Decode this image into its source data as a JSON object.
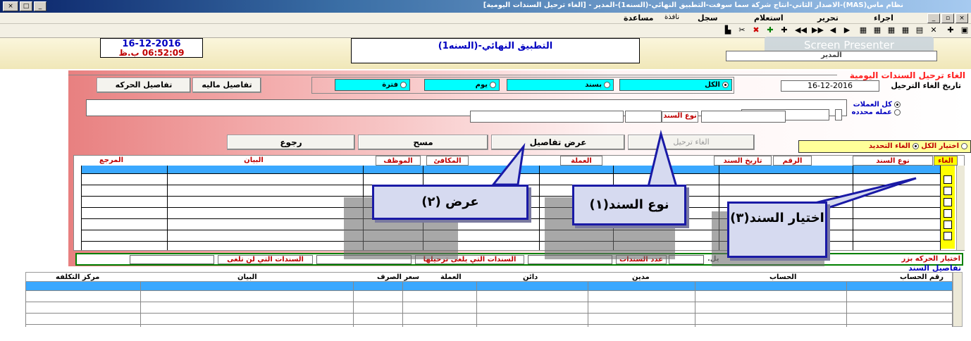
{
  "window": {
    "title": "نظام ماس(MAS)-الاصدار الثاني-انتاج شركة سما سوفت-التطبيق النهائي-(السنه1)-المدير - [الغاء ترحيل السندات اليومية]",
    "min": "_",
    "max": "□",
    "close": "×"
  },
  "menu": {
    "items": [
      "اجراء",
      "تحرير",
      "استعلام",
      "سجل",
      "نافذة",
      "مساعدة"
    ]
  },
  "header": {
    "date": "16-12-2016",
    "time": "06:52:09 ب.ظ",
    "app_name": "التطبيق النهائي-(السنه1)",
    "user_label": "المدير",
    "watermark": "Screen Presenter"
  },
  "form": {
    "title": "الغاء ترحيل السندات اليومية",
    "cancel_date_label": "تاريخ الغاء الترحيل",
    "cancel_date_value": "16-12-2016",
    "filters": {
      "all": "الكل",
      "by_voucher": "بسند",
      "day": "يوم",
      "period": "فترة"
    },
    "buttons": {
      "financial_details": "تفاصيل ماليه",
      "movement_details": "تفاصيل الحركه",
      "cancel_posting": "الغاء ترحيل",
      "show_details": "عرض تفاصيل",
      "clear": "مسح",
      "back": "رجوع"
    },
    "currency": {
      "all": "كل العملات",
      "specific": "عمله محدده"
    },
    "voucher_type_label": "نوع السند",
    "selection": {
      "select_all": "اختيار الكل",
      "cancel_selection": "الغاء التحديد"
    },
    "grid_columns": [
      "الغاء",
      "نوع السند",
      "الرقم",
      "تاريخ السند",
      "",
      "العملة",
      "المكافئ",
      "الموظف",
      "البيان",
      "المرجع"
    ],
    "status": {
      "hint": "اختيار الحركه بزر",
      "count_label": "عدد السندات",
      "will_cancel": "السندات التي يلغى ترحيلها",
      "wont_cancel": "السندات التي لن تلغى",
      "hint_tail": "يل."
    }
  },
  "details": {
    "title": "تفاصيل السند",
    "columns": [
      "رقم الحساب",
      "الحساب",
      "مدين",
      "دائن",
      "العملة",
      "سعر الصرف",
      "البيان",
      "مركز التكلفه"
    ]
  },
  "callouts": {
    "c1": "نوع السند(١)",
    "c2": "عرض (٢)",
    "c3": "اختيار السند(٣)"
  },
  "colors": {
    "cyan": "#00ffff",
    "select_blue": "#3aa8ff",
    "title_red": "#ff2020",
    "callout_border": "#1a1aa6"
  }
}
